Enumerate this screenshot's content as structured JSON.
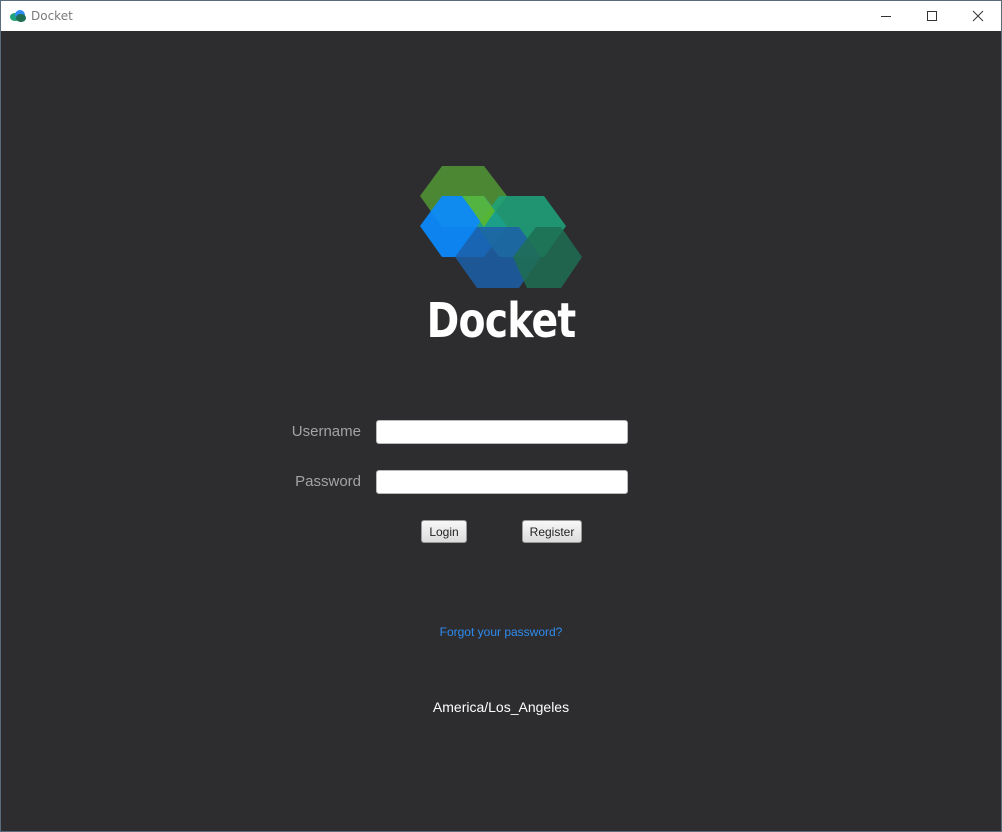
{
  "window": {
    "title": "Docket",
    "icons": {
      "app": "docket-cloud-icon",
      "minimize": "minimize-icon",
      "maximize": "maximize-icon",
      "close": "close-icon"
    }
  },
  "branding": {
    "logo_icon": "docket-hexagon-logo",
    "app_name": "Docket",
    "colors": {
      "green": "#5a8f3c",
      "blue": "#0a8bff",
      "teal": "#1fa37a",
      "dark_blue": "#1c5fa8",
      "dark_green": "#1f6e52"
    }
  },
  "form": {
    "username_label": "Username",
    "username_value": "",
    "password_label": "Password",
    "password_value": "",
    "login_label": "Login",
    "register_label": "Register",
    "forgot_password_label": "Forgot your password?"
  },
  "footer": {
    "timezone": "America/Los_Angeles"
  },
  "theme": {
    "background": "#2d2d30",
    "link": "#2e8cf0",
    "label": "#a3a3a3"
  }
}
